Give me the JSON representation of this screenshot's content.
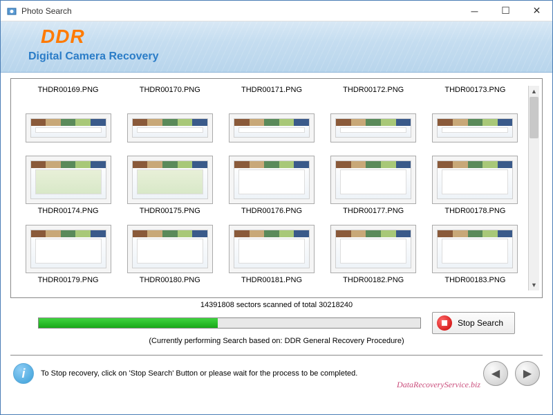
{
  "window": {
    "title": "Photo Search"
  },
  "banner": {
    "logo": "DDR",
    "subtitle": "Digital Camera Recovery"
  },
  "files": [
    {
      "name": "THDR00169.PNG"
    },
    {
      "name": "THDR00170.PNG"
    },
    {
      "name": "THDR00171.PNG"
    },
    {
      "name": "THDR00172.PNG"
    },
    {
      "name": "THDR00173.PNG"
    },
    {
      "name": "THDR00174.PNG"
    },
    {
      "name": "THDR00175.PNG"
    },
    {
      "name": "THDR00176.PNG"
    },
    {
      "name": "THDR00177.PNG"
    },
    {
      "name": "THDR00178.PNG"
    },
    {
      "name": "THDR00179.PNG"
    },
    {
      "name": "THDR00180.PNG"
    },
    {
      "name": "THDR00181.PNG"
    },
    {
      "name": "THDR00182.PNG"
    },
    {
      "name": "THDR00183.PNG"
    }
  ],
  "progress": {
    "status": "14391808 sectors scanned of total 30218240",
    "note": "(Currently performing Search based on:  DDR General Recovery Procedure)",
    "percent": 47,
    "stop_label": "Stop Search"
  },
  "footer": {
    "message": "To Stop recovery, click on 'Stop Search' Button or please wait for the process to be completed.",
    "watermark": "DataRecoveryService.biz"
  }
}
